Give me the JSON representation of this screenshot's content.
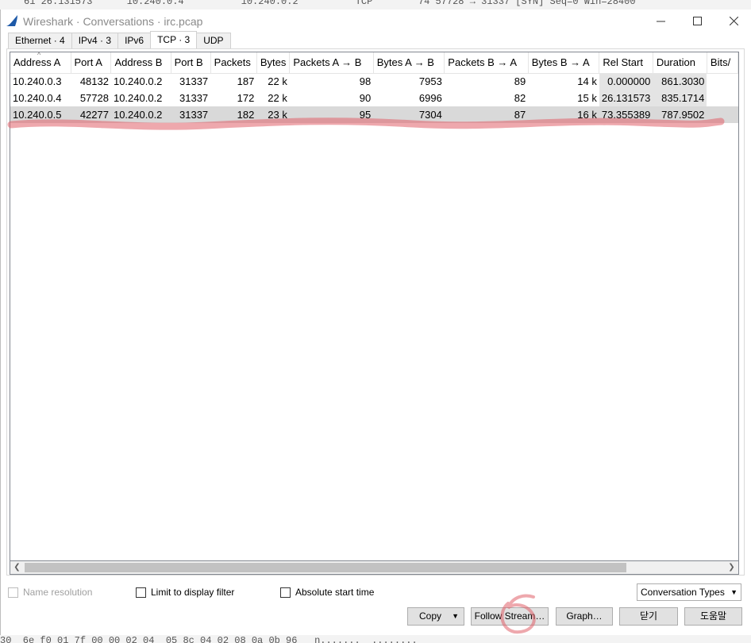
{
  "background": {
    "top_packet_line": "61 26.131573      10.240.0.4          10.240.0.2          TCP        74 57728 → 31337 [SYN] Seq=0 Win=28400",
    "bottom_hex_line": "30  6e f0 01 7f 00 00 02 04  05 8c 04 02 08 0a 0b 96   n.......  ........"
  },
  "window": {
    "title": "Wireshark · Conversations · irc.pcap",
    "app_icon": "wireshark-fin-icon",
    "minimize_icon": "minimize-icon",
    "maximize_icon": "maximize-icon",
    "close_icon": "close-icon"
  },
  "tabs": [
    {
      "label": "Ethernet · 4"
    },
    {
      "label": "IPv4 · 3"
    },
    {
      "label": "IPv6"
    },
    {
      "label": "TCP · 3",
      "active": true
    },
    {
      "label": "UDP"
    }
  ],
  "table": {
    "columns": [
      "Address A",
      "Port A",
      "Address B",
      "Port B",
      "Packets",
      "Bytes",
      "Packets A → B",
      "Bytes A → B",
      "Packets B → A",
      "Bytes B → A",
      "Rel Start",
      "Duration",
      "Bits/"
    ],
    "sorted_column": "Address A",
    "rows": [
      [
        "10.240.0.3",
        "48132",
        "10.240.0.2",
        "31337",
        "187",
        "22 k",
        "98",
        "7953",
        "89",
        "14 k",
        "0.000000",
        "861.3030"
      ],
      [
        "10.240.0.4",
        "57728",
        "10.240.0.2",
        "31337",
        "172",
        "22 k",
        "90",
        "6996",
        "82",
        "15 k",
        "26.131573",
        "835.1714"
      ],
      [
        "10.240.0.5",
        "42277",
        "10.240.0.2",
        "31337",
        "182",
        "23 k",
        "95",
        "7304",
        "87",
        "16 k",
        "73.355389",
        "787.9502"
      ]
    ],
    "selected_row": 2
  },
  "controls": {
    "name_resolution": {
      "label": "Name resolution",
      "checked": false,
      "enabled": false
    },
    "limit_filter": {
      "label": "Limit to display filter",
      "checked": false
    },
    "absolute_time": {
      "label": "Absolute start time",
      "checked": false
    },
    "conversation_types": "Conversation Types",
    "copy": "Copy",
    "follow_stream": "Follow Stream…",
    "graph": "Graph…",
    "close": "닫기",
    "help": "도움말"
  },
  "colors": {
    "accent_blue": "#1e5aa8",
    "selection_gray": "#d9d9d9",
    "annotation_red": "#e0606a"
  }
}
